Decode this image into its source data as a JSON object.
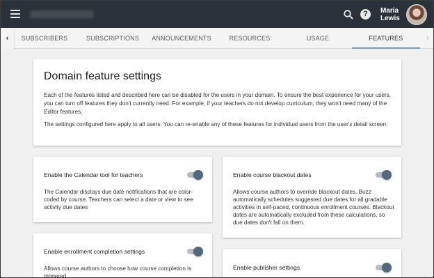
{
  "topbar": {
    "user_first": "Maria",
    "user_last": "Lewis",
    "bar_color": "#2b3138"
  },
  "tabs": [
    {
      "label": "SUBSCRIBERS"
    },
    {
      "label": "SUBSCRIPTIONS"
    },
    {
      "label": "ANNOUNCEMENTS"
    },
    {
      "label": "RESOURCES"
    },
    {
      "label": "USAGE"
    },
    {
      "label": "FEATURES",
      "active": true
    }
  ],
  "intro": {
    "title": "Domain feature settings",
    "para1": "Each of the features listed and described here can be disabled for the users in your domain. To ensure the best experience for your users, you can turn off features they don't currently need. For example, if your teachers do not develop curriculum, they won't need many of the Editor features.",
    "para2": "The settings configured here apply to all users. You can re-enable any of these features for individual users from the user's detail screen."
  },
  "settings": [
    {
      "title": "Enable the Calendar tool for teachers",
      "desc": "The Calendar displays due date notifications that are color-coded by course. Teachers can select a date or view to see activity due dates",
      "enabled": true
    },
    {
      "title": "Enable course blackout dates",
      "desc": "Allows course authors to override blackout dates. Buzz automatically schedules suggested due dates for all gradable activities in self-paced, continuous enrollment courses. Blackout dates are automatically excluded from these calculations, so due dates don't fall on them.",
      "enabled": true
    },
    {
      "title": "Enable enrollment completion settings",
      "desc": "Allows course authors to choose how course completion is triggered",
      "enabled": true
    },
    {
      "title": "Enable publisher settings",
      "desc": "",
      "enabled": true
    }
  ],
  "colors": {
    "toggle_knob": "#51687d",
    "toggle_track": "#b7bdc3",
    "active_tab_underline": "#7e9bb3"
  }
}
